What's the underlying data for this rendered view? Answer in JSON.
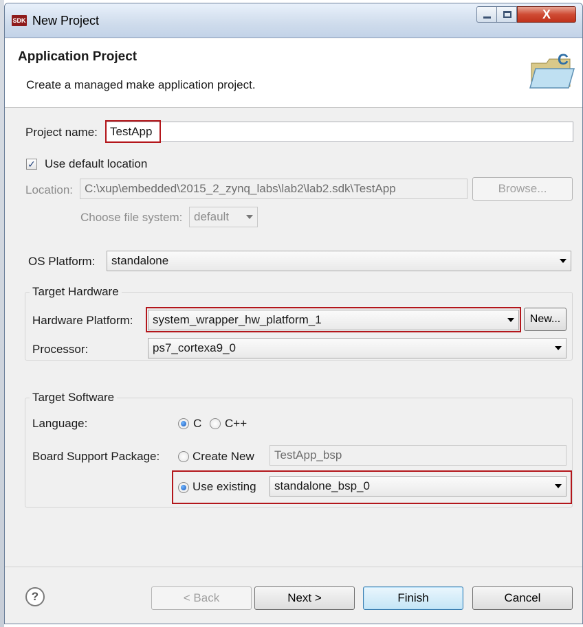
{
  "window": {
    "title": "New Project",
    "app_icon_text": "SDK",
    "close_glyph": "X"
  },
  "header": {
    "title": "Application Project",
    "description": "Create a managed make application project.",
    "icon_letter": "C"
  },
  "project": {
    "name_label": "Project name:",
    "name_value": "TestApp",
    "use_default_label": "Use default location",
    "use_default_checked": true,
    "check_glyph": "✓",
    "location_label": "Location:",
    "location_value": "C:\\xup\\embedded\\2015_2_zynq_labs\\lab2\\lab2.sdk\\TestApp",
    "browse_label": "Browse...",
    "filesystem_label": "Choose file system:",
    "filesystem_value": "default"
  },
  "os": {
    "label": "OS Platform:",
    "value": "standalone"
  },
  "target_hardware": {
    "group_title": "Target Hardware",
    "platform_label": "Hardware Platform:",
    "platform_value": "system_wrapper_hw_platform_1",
    "new_label": "New...",
    "processor_label": "Processor:",
    "processor_value": "ps7_cortexa9_0"
  },
  "target_software": {
    "group_title": "Target Software",
    "language_label": "Language:",
    "lang_c": "C",
    "lang_cpp": "C++",
    "selected_language": "C",
    "bsp_label": "Board Support Package:",
    "create_new_label": "Create New",
    "create_new_value": "TestApp_bsp",
    "use_existing_label": "Use existing",
    "use_existing_value": "standalone_bsp_0"
  },
  "footer": {
    "help_glyph": "?",
    "back_label": "< Back",
    "next_label": "Next >",
    "finish_label": "Finish",
    "cancel_label": "Cancel"
  },
  "colors": {
    "highlight": "#b3161b",
    "radio_selected": "#1c59b8",
    "default_button": "#3c7fb1"
  }
}
